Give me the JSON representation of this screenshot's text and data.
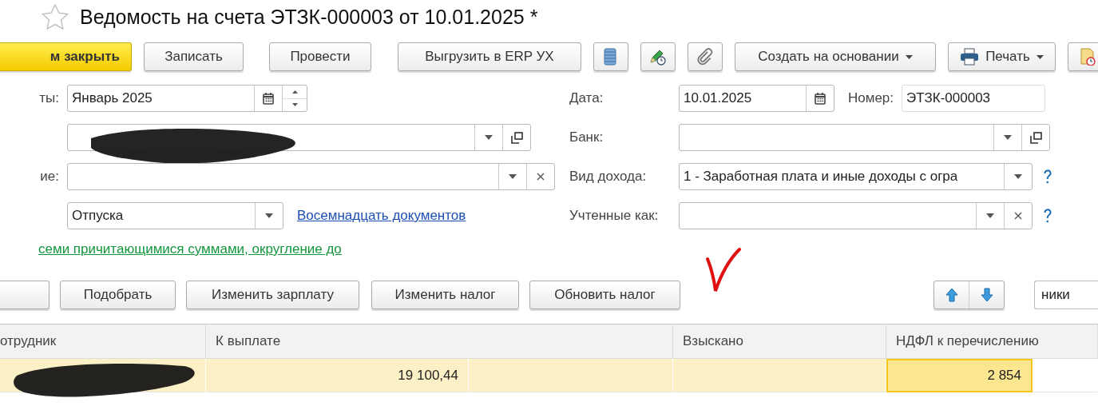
{
  "window": {
    "title": "Ведомость на счета ЭТЗК-000003 от 10.01.2025 *",
    "favorite": false
  },
  "toolbar": [
    {
      "kind": "primary",
      "label": "м закрыть"
    },
    {
      "kind": "button",
      "label": "Записать"
    },
    {
      "kind": "button",
      "label": "Провести"
    },
    {
      "kind": "button",
      "label": "Выгрузить в ERP УХ"
    },
    {
      "kind": "icon"
    },
    {
      "kind": "icon"
    },
    {
      "kind": "icon"
    },
    {
      "kind": "menu",
      "label": "Создать на основании"
    },
    {
      "kind": "print-menu",
      "label": "Печать"
    },
    {
      "kind": "icon"
    }
  ],
  "form_left": [
    {
      "label": "ты:",
      "kind": "period",
      "value": "Январь 2025"
    },
    {
      "kind": "org",
      "redacted": true
    },
    {
      "label": "ие:",
      "kind": "clearable"
    },
    {
      "kind": "choice",
      "value": "Отпуска",
      "link": "Восемнадцать документов"
    }
  ],
  "form_right": [
    {
      "label": "Дата:",
      "kind": "date",
      "value": "10.01.2025",
      "extra_label": "Номер:",
      "extra_value": "ЭТЗК-000003"
    },
    {
      "label": "Банк:",
      "kind": "open"
    },
    {
      "label": "Вид дохода:",
      "kind": "choice-help",
      "value": "1 - Заработная плата и иные доходы с огра"
    },
    {
      "label": "Учтенные как:",
      "kind": "clearable-help"
    }
  ],
  "payment_link": "семи причитающимися суммами, округление до",
  "table_toolbar": {
    "buttons": [
      {
        "kind": "cut"
      },
      {
        "kind": "button",
        "label": "Подобрать"
      },
      {
        "kind": "button",
        "label": "Изменить зарплату"
      },
      {
        "kind": "button",
        "label": "Изменить налог"
      },
      {
        "kind": "button",
        "label": "Обновить налог"
      }
    ],
    "annotation": {
      "kind": "checkmark"
    },
    "search": {
      "value": "ники"
    }
  },
  "table": {
    "columns": [
      "отрудник",
      "К выплате",
      "Взыскано",
      "НДФЛ к перечислению"
    ],
    "rows": [
      {
        "selected": true,
        "employee_redacted": true,
        "to_pay": "19 100,44",
        "ndfl": "2 854",
        "ndfl_selected": true
      }
    ]
  }
}
